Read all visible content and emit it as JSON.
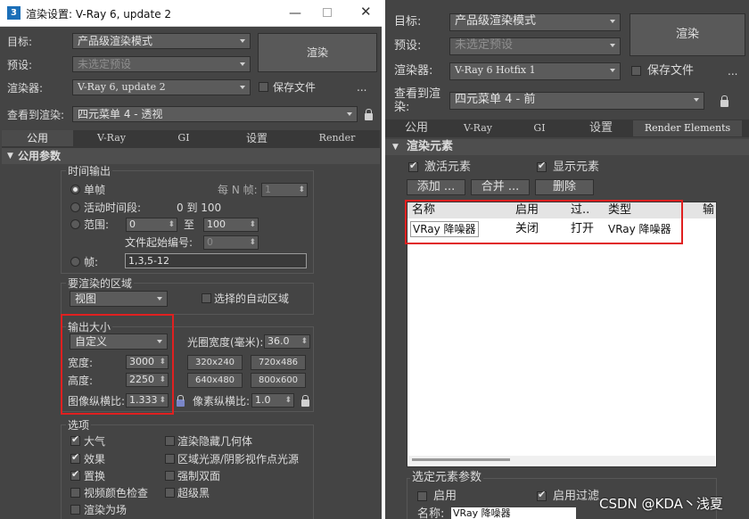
{
  "left": {
    "window_title": "渲染设置: V-Ray 6, update 2",
    "target_label": "目标:",
    "target_value": "产品级渲染模式",
    "preset_label": "预设:",
    "preset_value": "未选定预设",
    "renderer_label": "渲染器:",
    "renderer_value": "V-Ray 6, update 2",
    "render_button": "渲染",
    "save_file_label": "保存文件",
    "more_dots": "...",
    "view_label": "查看到渲染:",
    "view_value": "四元菜单 4 - 透视",
    "tabs": [
      "公用",
      "V-Ray",
      "GI",
      "设置",
      "Render Elements"
    ],
    "rollout_title": "公用参数",
    "time_output": {
      "title": "时间输出",
      "single": "单帧",
      "every_n": "每 N 帧:",
      "every_n_value": "1",
      "active_segment": "活动时间段:",
      "active_range": "0 到 100",
      "range": "范围:",
      "range_from": "0",
      "range_to_label": "至",
      "range_to": "100",
      "file_start": "文件起始编号:",
      "file_start_value": "0",
      "frames": "帧:",
      "frames_value": "1,3,5-12"
    },
    "area": {
      "title": "要渲染的区域",
      "value": "视图",
      "auto_region": "选择的自动区域"
    },
    "output_size": {
      "title": "输出大小",
      "preset": "自定义",
      "aperture_label": "光圈宽度(毫米):",
      "aperture_value": "36.0",
      "width_label": "宽度:",
      "width_value": "3000",
      "height_label": "高度:",
      "height_value": "2250",
      "aspect_label": "图像纵横比:",
      "aspect_value": "1.333",
      "pixel_aspect_label": "像素纵横比:",
      "pixel_aspect_value": "1.0",
      "presets": [
        "320x240",
        "720x486",
        "640x480",
        "800x600"
      ]
    },
    "options": {
      "title": "选项",
      "items": [
        {
          "label": "大气",
          "checked": true
        },
        {
          "label": "效果",
          "checked": true
        },
        {
          "label": "置换",
          "checked": true
        },
        {
          "label": "视频颜色检查",
          "checked": false
        },
        {
          "label": "渲染为场",
          "checked": false
        }
      ],
      "items_right": [
        {
          "label": "渲染隐藏几何体",
          "checked": false
        },
        {
          "label": "区域光源/阴影视作点光源",
          "checked": false
        },
        {
          "label": "强制双面",
          "checked": false
        },
        {
          "label": "超级黑",
          "checked": false
        }
      ]
    }
  },
  "right": {
    "target_label": "目标:",
    "target_value": "产品级渲染模式",
    "preset_label": "预设:",
    "preset_value": "未选定预设",
    "renderer_label": "渲染器:",
    "renderer_value": "V-Ray 6 Hotfix 1",
    "render_button": "渲染",
    "save_file_label": "保存文件",
    "more_dots": "...",
    "view_label_1": "查看到渲",
    "view_label_2": "染:",
    "view_value": "四元菜单 4 - 前",
    "tabs": [
      "公用",
      "V-Ray",
      "GI",
      "设置",
      "Render Elements"
    ],
    "rollout_title": "渲染元素",
    "activate": "激活元素",
    "show": "显示元素",
    "add_btn": "添加 ...",
    "merge_btn": "合并 ...",
    "delete_btn": "删除",
    "table_headers": [
      "名称",
      "启用",
      "过..",
      "类型",
      "输"
    ],
    "table_rows": [
      [
        "VRay 降噪器",
        "关闭",
        "打开",
        "VRay 降噪器"
      ]
    ],
    "selected_params": "选定元素参数",
    "enable": "启用",
    "enable_filter": "启用过滤",
    "name_label": "名称:",
    "name_value": "VRay 降噪器"
  },
  "watermark": "CSDN @KDA丶浅夏"
}
